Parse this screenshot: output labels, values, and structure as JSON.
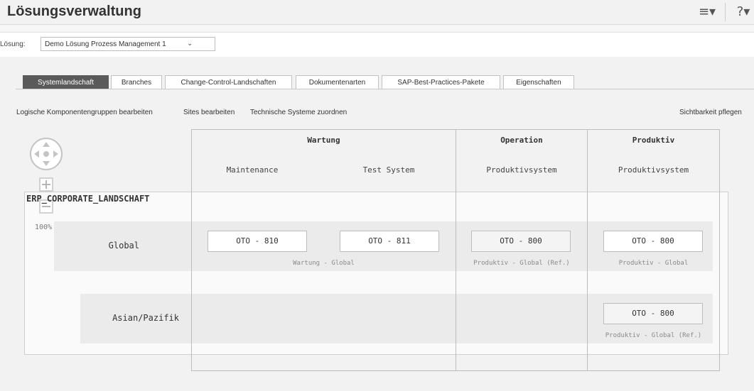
{
  "app": {
    "title": "Lösungsverwaltung"
  },
  "header_icons": [
    {
      "name": "list-icon",
      "glyph": "≡▾"
    },
    {
      "name": "help-icon",
      "glyph": "?▾"
    }
  ],
  "solution": {
    "label": "Lösung:",
    "value": "Demo Lösung Prozess Management 1",
    "chevron": "⌄"
  },
  "tabs": [
    {
      "label": "Systemlandschaft",
      "active": true
    },
    {
      "label": "Branches",
      "active": false
    },
    {
      "label": "Change-Control-Landschaften",
      "active": false
    },
    {
      "label": "Dokumentenarten",
      "active": false
    },
    {
      "label": "SAP-Best-Practices-Pakete",
      "active": false
    },
    {
      "label": "Eigenschaften",
      "active": false
    }
  ],
  "actions": {
    "edit_groups": "Logische Komponentengruppen bearbeiten",
    "edit_sites": "Sites bearbeiten",
    "assign_systems": "Technische Systeme zuordnen",
    "visibility": "Sichtbarkeit pflegen"
  },
  "zoom": {
    "level": "100%",
    "plus": "+",
    "minus": "−"
  },
  "landscape": {
    "name": "ERP_CORPORATE_LANDSCHAFT",
    "columns": [
      {
        "title": "Wartung",
        "subcolumns": [
          "Maintenance",
          "Test System"
        ]
      },
      {
        "title": "Operation",
        "subcolumns": [
          "Produktivsystem"
        ]
      },
      {
        "title": "Produktiv",
        "subcolumns": [
          "Produktivsystem"
        ]
      }
    ],
    "rows": [
      {
        "label": "Global",
        "systems": [
          "OTO - 810",
          "OTO - 811",
          "OTO - 800",
          "OTO - 800"
        ],
        "captions": [
          "Wartung - Global",
          "Produktiv - Global (Ref.)",
          "Produktiv - Global"
        ]
      },
      {
        "label": "Asian/Pazifik",
        "systems": [
          "OTO - 800"
        ],
        "captions": [
          "Produktiv - Global (Ref.)"
        ]
      }
    ]
  }
}
